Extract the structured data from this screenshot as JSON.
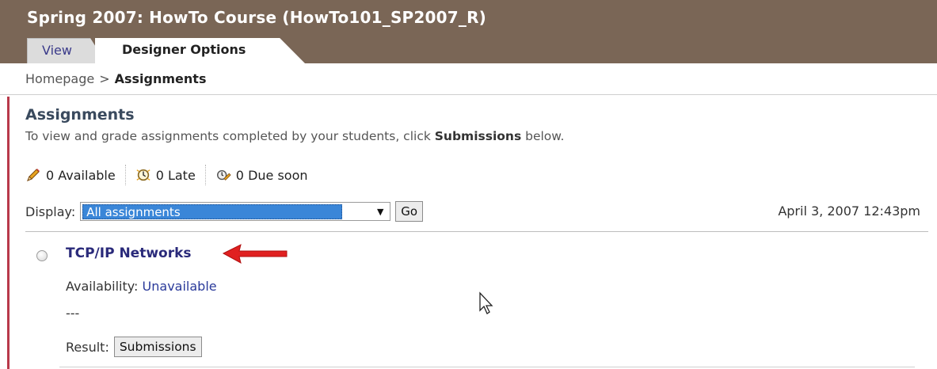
{
  "header": {
    "course_title": "Spring 2007: HowTo Course  (HowTo101_SP2007_R)",
    "tabs": [
      {
        "label": "View",
        "active": false
      },
      {
        "label": "Designer Options",
        "active": true
      }
    ],
    "background_color": "#7a6656"
  },
  "breadcrumb": {
    "home": "Homepage",
    "separator": ">",
    "current": "Assignments"
  },
  "page": {
    "title": "Assignments",
    "intro_prefix": "To view and grade assignments completed by your students, click ",
    "intro_bold": "Submissions",
    "intro_suffix": " below."
  },
  "stats": [
    {
      "icon": "pencil-icon",
      "label": "0 Available"
    },
    {
      "icon": "clock-icon",
      "label": "0 Late"
    },
    {
      "icon": "due-soon-icon",
      "label": "0 Due soon"
    }
  ],
  "filter": {
    "label": "Display:",
    "selected": "All assignments",
    "go_label": "Go"
  },
  "timestamp": "April 3, 2007 12:43pm",
  "assignments": [
    {
      "title": "TCP/IP Networks",
      "availability_label": "Availability:",
      "availability_value": "Unavailable",
      "description": "---",
      "result_label": "Result:",
      "submissions_label": "Submissions"
    }
  ],
  "colors": {
    "accent_bar": "#b8394a",
    "link": "#2a2a7a",
    "select_highlight": "#3a86d8",
    "annotation_arrow": "#e02020"
  }
}
